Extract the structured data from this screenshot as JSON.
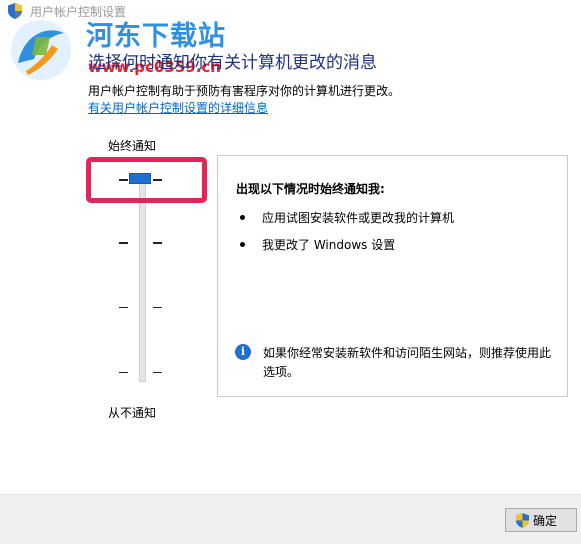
{
  "window": {
    "title": "用户帐户控制设置"
  },
  "watermark": {
    "site_name": "河东下载站",
    "site_url": "www.pc0359.cn"
  },
  "main": {
    "heading": "选择何时通知你有关计算机更改的消息",
    "description": "用户帐户控制有助于预防有害程序对你的计算机进行更改。",
    "details_link": "有关用户帐户控制设置的详细信息"
  },
  "slider": {
    "top_label": "始终通知",
    "bottom_label": "从不通知",
    "levels": 4,
    "selected_level": 1
  },
  "panel": {
    "title": "出现以下情况时始终通知我:",
    "bullets": [
      "应用试图安装软件或更改我的计算机",
      "我更改了 Windows 设置"
    ],
    "recommendation": "如果你经常安装新软件和访问陌生网站，则推荐使用此选项。"
  },
  "footer": {
    "ok_label": "确定"
  },
  "colors": {
    "heading": "#1e3287",
    "link": "#0066cc",
    "slider_thumb": "#1f6fd1",
    "highlight": "#e5245c",
    "watermark_blue": "#2f8fe0",
    "watermark_red": "#e8232a"
  }
}
